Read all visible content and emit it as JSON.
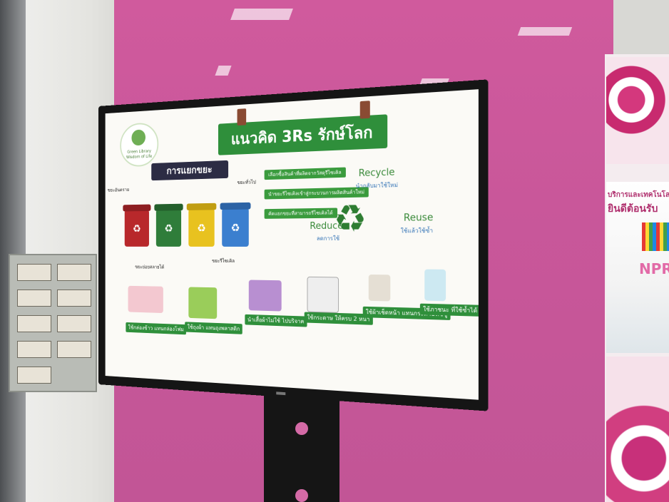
{
  "screen": {
    "title": "แนวคิด 3Rs รักษ์โลก",
    "logo_line1": "Green Library",
    "logo_line2": "Wisdom of Life",
    "sorting_title": "การแยกขยะ",
    "bins": [
      {
        "label": "ขยะอันตราย",
        "color": "#b8282b"
      },
      {
        "label": "ขยะย่อยสลายได้",
        "color": "#2f7d3a"
      },
      {
        "label": "ขยะรีไซเคิล",
        "color": "#e8c21f"
      },
      {
        "label": "ขยะทั่วไป",
        "color": "#3b7fcf"
      }
    ],
    "tips": [
      "เลือกซื้อสินค้าที่ผลิตจากวัสดุรีไซเคิล",
      "นำขยะรีไซเคิลเข้าสู่กระบวนการผลิตสินค้าใหม่",
      "คัดแยกขยะที่สามารถรีไซเคิลได้"
    ],
    "recycle": {
      "title": "Recycle",
      "subtitle": "นำกลับมาใช้ใหม่"
    },
    "reduce": {
      "title": "Reduce",
      "subtitle": "ลดการใช้"
    },
    "reuse": {
      "title": "Reuse",
      "subtitle": "ใช้แล้วใช้ซ้ำ"
    },
    "captions": [
      "ใช้กล่องข้าว แทนกล่องโฟม",
      "ใช้ถุงผ้า แทนถุงพลาสติก",
      "นำเสื้อผ้าไม่ใช้ ไปบริจาค",
      "ใช้กระดาษ ให้ครบ 2 หน้า",
      "ใช้ผ้าเช็ดหน้า แทนกระดาษทิชชู",
      "ใช้ภาชนะ ที่ใช้ซ้ำได้"
    ]
  },
  "signage_right": {
    "line1": "บริการและเทคโนโลยีฯ",
    "line2": "ยินดีต้อนรับ",
    "npr": "NPR"
  },
  "colors": {
    "wall": "#c9579a",
    "banner": "#2f8f3b",
    "tv_frame": "#151515"
  }
}
